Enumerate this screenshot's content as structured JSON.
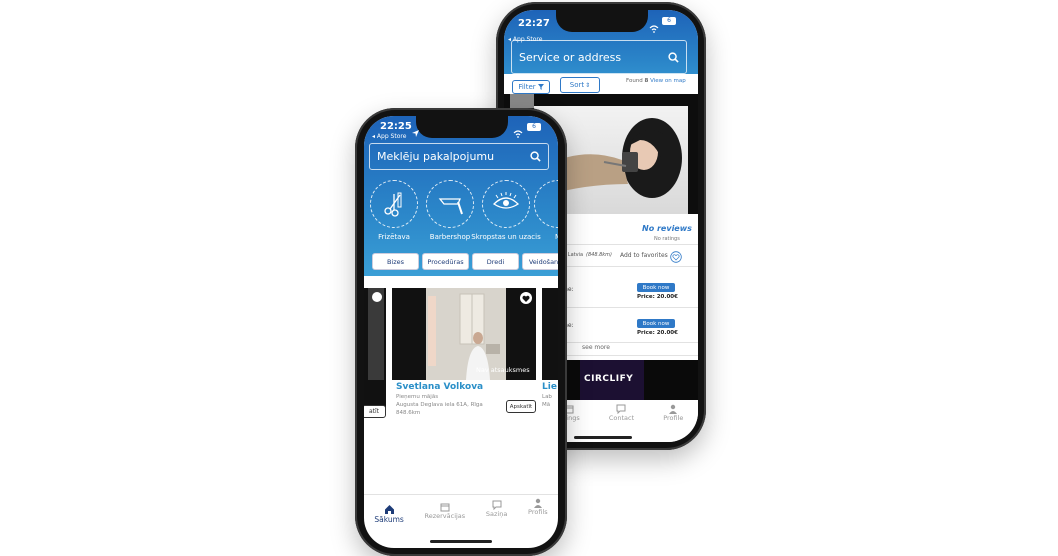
{
  "back_phone": {
    "status": {
      "time": "22:27",
      "back_label": "◂ App Store",
      "battery": "6"
    },
    "search": {
      "placeholder": "Service or address"
    },
    "filter_label": "Filter",
    "sort_label": "Sort",
    "found_prefix": "Found",
    "found_count": "8",
    "view_on_map": "View on map",
    "rating": {
      "title": "No reviews",
      "subtitle": "No ratings"
    },
    "address_partial": "s, Latvia",
    "distance": "(848.8km)",
    "favorites_label": "Add to favorites",
    "slots": [
      {
        "label": "me:",
        "book_label": "Book now",
        "price": "Price: 20.00€"
      },
      {
        "label": "me:",
        "book_label": "Book now",
        "price": "Price: 20.00€"
      }
    ],
    "see_more": "see more",
    "banner_text": "CIRCLIFY",
    "tabs": [
      {
        "label": "okings",
        "icon": "calendar-icon"
      },
      {
        "label": "Contact",
        "icon": "chat-icon"
      },
      {
        "label": "Profile",
        "icon": "user-icon"
      }
    ]
  },
  "front_phone": {
    "status": {
      "time": "22:25",
      "back_label": "◂ App Store",
      "battery": "6"
    },
    "search": {
      "placeholder": "Meklēju pakalpojumu"
    },
    "categories": [
      {
        "label": "Frizētava",
        "icon": "scissors-comb-icon"
      },
      {
        "label": "Barbershop",
        "icon": "straight-razor-icon"
      },
      {
        "label": "Skropstas un uzacis",
        "icon": "eyelash-icon"
      },
      {
        "label": "M",
        "icon": "more-category-icon"
      }
    ],
    "filters": [
      "Bizes",
      "Procedūras",
      "Dredi",
      "Veidošana"
    ],
    "card": {
      "name": "Svetlana Volkova",
      "subtitle": "Pieņemu mājās",
      "address": "Augusta Deglava iela 61A, Rīga",
      "distance": "848.6km",
      "overlay": "Nav atsauksmes",
      "button": "Apskatīt"
    },
    "left_card_button": "atīt",
    "right_card": {
      "name": "Lie",
      "line1": "Lab",
      "line2": "Mā"
    },
    "tabs": [
      {
        "label": "Sākums",
        "icon": "home-icon",
        "active": true
      },
      {
        "label": "Rezervācijas",
        "icon": "calendar-icon",
        "active": false
      },
      {
        "label": "Saziņa",
        "icon": "chat-icon",
        "active": false
      },
      {
        "label": "Profils",
        "icon": "user-icon",
        "active": false
      }
    ]
  },
  "colors": {
    "header_blue": "#2b86c9",
    "navy": "#1e3c78",
    "accent_blue": "#2f79c7",
    "card_title": "#2a8fc8"
  }
}
